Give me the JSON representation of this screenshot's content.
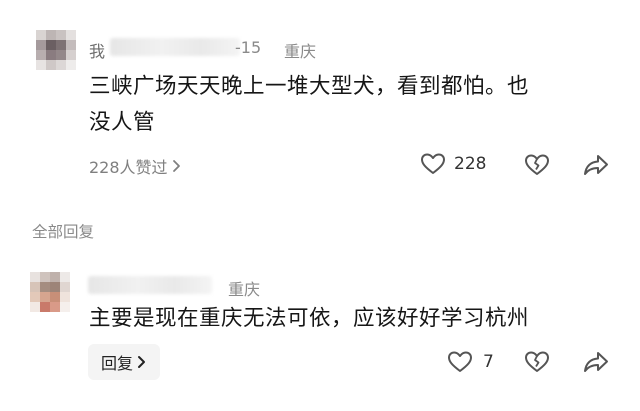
{
  "comments": [
    {
      "user_fragment": "我",
      "date": "-15",
      "location": "重庆",
      "text_line1": "三峡广场天天晚上一堆大型犬，看到都怕。也",
      "text_line2": "没人管",
      "likes_summary": "228人赞过",
      "like_count": "228"
    },
    {
      "location": "重庆",
      "text": "主要是现在重庆无法可依，应该好好学习杭州",
      "reply_label": "回复",
      "like_count": "7"
    }
  ],
  "section": {
    "label": "全部回复"
  },
  "icons": {
    "like": "heart-icon",
    "dislike": "broken-heart-icon",
    "share": "share-icon",
    "chevron": "chevron-right-icon"
  },
  "colors": {
    "text": "#161616",
    "meta": "#8a8a8a",
    "icon": "#555555",
    "reply_bg": "#f4f4f4"
  }
}
